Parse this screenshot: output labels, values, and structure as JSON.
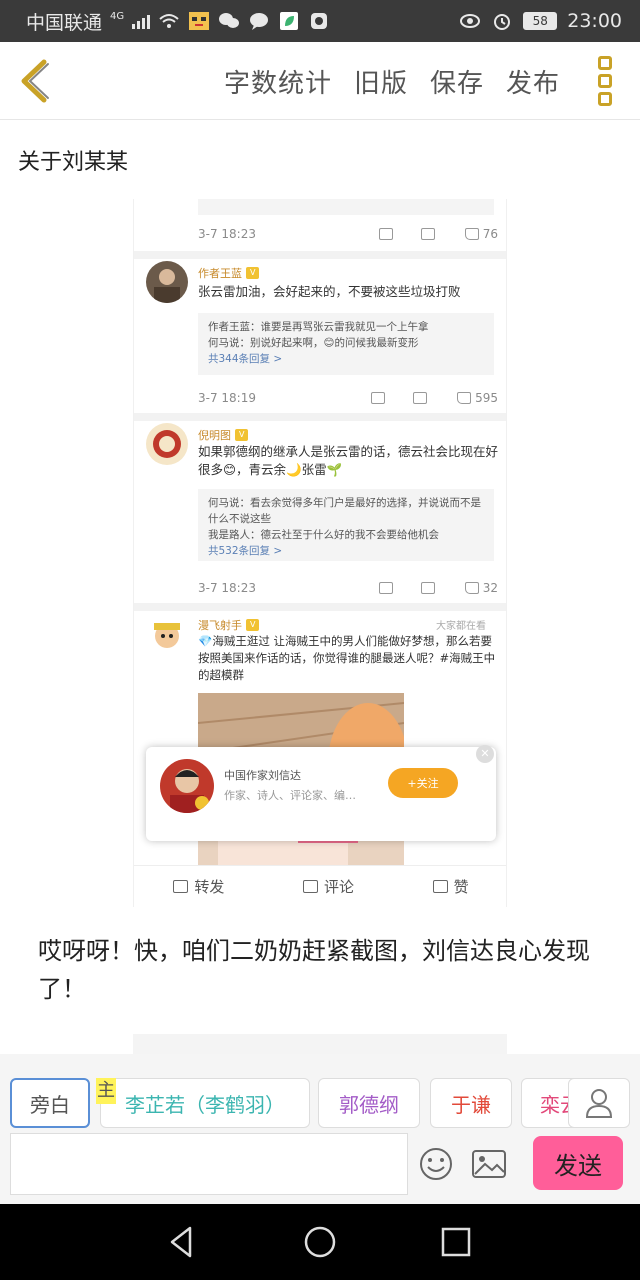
{
  "status_bar": {
    "carrier": "中国联通",
    "network": "4G",
    "battery": "58",
    "time": "23:00"
  },
  "toolbar": {
    "word_count": "字数统计",
    "old_version": "旧版",
    "save": "保存",
    "publish": "发布"
  },
  "document": {
    "title": "关于刘某某"
  },
  "embedded_screenshot": {
    "top_meta": {
      "date": "3-7 18:23",
      "likes": "76"
    },
    "comments": [
      {
        "name": "作者王蓝",
        "text": "张云雷加油，会好起来的，不要被这些垃圾打败",
        "replies": [
          "作者王蓝：谁要是再骂张云雷我就见一个上午拿",
          "何马说：别说好起来啊，😊的问候我最新变形"
        ],
        "more": "共344条回复 >",
        "date": "3-7 18:19",
        "likes": "595"
      },
      {
        "name": "倪明图",
        "text": "如果郭德纲的继承人是张云雷的话，德云社会比现在好很多😊，青云余🌙张雷🌱",
        "replies": [
          "何马说：看去余觉得多年门户是最好的选择，并说说而不是什么不说这些",
          "我是路人：德云社至于什么好的我不会要给他机会"
        ],
        "more": "共532条回复 >",
        "date": "3-7 18:23",
        "likes": "32"
      },
      {
        "name": "漫飞射手",
        "text": "💎海贼王逛过 让海贼王中的男人们能做好梦想，那么若要按照美国来作话的话，你觉得谁的腿最迷人呢？#海贼王中的超模群",
        "tag": "大家都在看"
      }
    ],
    "follow_card": {
      "name": "中国作家刘信达",
      "desc": "作家、诗人、评论家、编…",
      "button": "+关注"
    },
    "actions": {
      "repost": "转发",
      "comment": "评论",
      "like": "赞"
    }
  },
  "narration": "哎呀呀！快，咱们二奶奶赶紧截图，刘信达良心发现了！",
  "roles": [
    {
      "label": "旁白",
      "color": "#555555"
    },
    {
      "label": "李芷若（李鹤羽）",
      "color": "#3bb5b0"
    },
    {
      "label": "郭德纲",
      "color": "#a35cc7"
    },
    {
      "label": "于谦",
      "color": "#e24a3a"
    },
    {
      "label": "栾云",
      "color": "#e2497a"
    }
  ],
  "main_badge": "主",
  "send_button": "发送",
  "colors": {
    "accent_gold": "#c9a227",
    "send_pink": "#ff5e99",
    "follow_orange": "#f5a623"
  }
}
